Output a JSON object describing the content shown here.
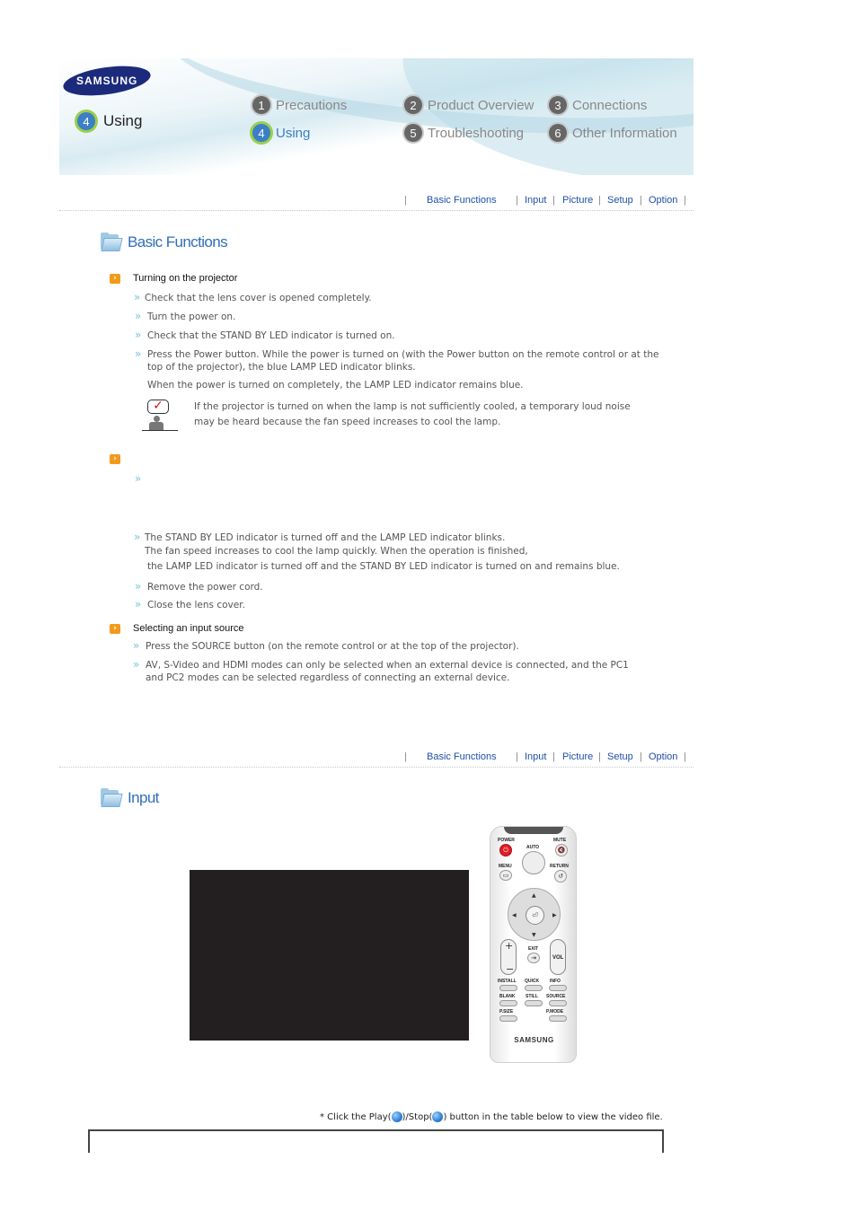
{
  "header": {
    "logo": "SAMSUNG",
    "current_section": {
      "number": "4",
      "label": "Using"
    },
    "nav": [
      {
        "number": "1",
        "label": "Precautions",
        "active": false
      },
      {
        "number": "2",
        "label": "Product Overview",
        "active": false
      },
      {
        "number": "3",
        "label": "Connections",
        "active": false
      },
      {
        "number": "4",
        "label": "Using",
        "active": true
      },
      {
        "number": "5",
        "label": "Troubleshooting",
        "active": false
      },
      {
        "number": "6",
        "label": "Other Information",
        "active": false
      }
    ]
  },
  "subnav": {
    "separator": "|",
    "links": [
      "Basic Functions",
      "Input",
      "Picture",
      "Setup",
      "Option"
    ]
  },
  "basic_functions": {
    "title": "Basic Functions",
    "turning_on": {
      "heading": "Turning on the projector",
      "steps": [
        "Check that the lens cover is opened completely.",
        "Turn the power on.",
        "Check that the STAND BY LED indicator is turned on.",
        "Press the Power button. While the power is turned on (with the Power button on the remote control or at the",
        "top of the projector), the blue LAMP LED indicator blinks.",
        "When the power is turned on completely, the LAMP LED indicator remains blue."
      ],
      "note": [
        "If the projector is turned on when the lamp is not sufficiently cooled, a temporary loud noise",
        "may be heard because the fan speed increases to cool the lamp."
      ]
    },
    "turning_off": {
      "heading": "",
      "steps": [
        "The STAND BY LED indicator is turned off and the LAMP LED indicator blinks.",
        "The fan speed increases to cool the lamp quickly. When the operation is finished,",
        "the LAMP LED indicator is turned off and the STAND BY LED indicator is turned on and remains blue.",
        "Remove the power cord.",
        "Close the lens cover."
      ]
    },
    "selecting_input": {
      "heading": "Selecting an input source",
      "steps": [
        "Press the SOURCE button (on the remote control or at the top of the projector).",
        "AV, S-Video and HDMI modes can only be selected when an external device is connected, and the PC1",
        "and PC2 modes can be selected regardless of connecting an external device."
      ]
    }
  },
  "input": {
    "title": "Input",
    "remote": {
      "labels": {
        "power": "POWER",
        "mute": "MUTE",
        "auto": "AUTO",
        "menu": "MENU",
        "return": "RETURN",
        "exit": "EXIT",
        "vol": "VOL",
        "install": "INSTALL",
        "quick": "QUICK",
        "info": "INFO",
        "blank": "BLANK",
        "still": "STILL",
        "source": "SOURCE",
        "psize": "P.SIZE",
        "pmode": "P.MODE",
        "brand": "SAMSUNG"
      }
    },
    "footnote": {
      "prefix": "* Click the Play(",
      "middle": ")/Stop(",
      "suffix": ") button in the table below to view the video file."
    }
  },
  "colors": {
    "accent_blue": "#2f6fba",
    "link_blue": "#1f4fa8",
    "orange_bullet": "#f29a1b",
    "chevron": "#7cc3d8"
  }
}
